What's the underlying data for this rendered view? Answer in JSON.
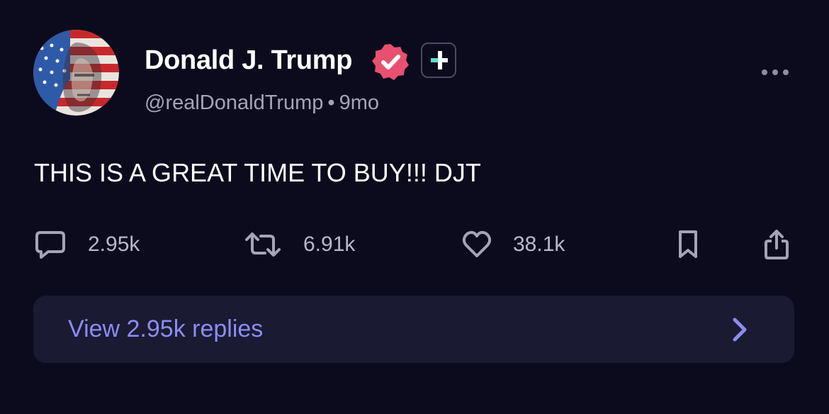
{
  "author": {
    "name": "Donald J. Trump",
    "handle": "@realDonaldTrump",
    "separator": "•",
    "time": "9mo"
  },
  "post": {
    "text": "THIS IS A GREAT TIME TO BUY!!! DJT"
  },
  "actions": {
    "replies": "2.95k",
    "reposts": "6.91k",
    "likes": "38.1k"
  },
  "replies_button": {
    "label": "View 2.95k replies"
  },
  "icons": {
    "avatar": "flag-portrait-avatar",
    "verified": "verified-badge-icon",
    "plus": "plus-badge-icon",
    "more": "more-dots-icon",
    "reply": "reply-icon",
    "repost": "repost-icon",
    "like": "heart-icon",
    "bookmark": "bookmark-icon",
    "share": "share-icon",
    "chevron": "chevron-right-icon"
  },
  "colors": {
    "background": "#0c0b1d",
    "verified": "#e8506f",
    "link": "#8c8cf0",
    "muted": "#a3a4b7",
    "replies_bg": "#1b1a33",
    "plus_accent": "#5be0c8"
  }
}
